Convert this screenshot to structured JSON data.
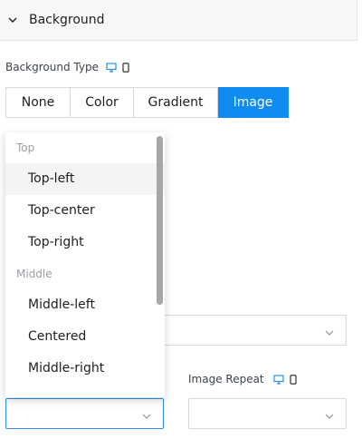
{
  "panel": {
    "title": "Background"
  },
  "background_type": {
    "label": "Background Type",
    "options": [
      "None",
      "Color",
      "Gradient",
      "Image"
    ],
    "selected": "Image"
  },
  "position_dropdown": {
    "groups": [
      {
        "label": "Top",
        "items": [
          "Top-left",
          "Top-center",
          "Top-right"
        ]
      },
      {
        "label": "Middle",
        "items": [
          "Middle-left",
          "Centered",
          "Middle-right"
        ]
      }
    ],
    "hovered": "Top-left"
  },
  "image_repeat": {
    "label": "Image Repeat"
  },
  "colors": {
    "accent": "#0f8cf2",
    "border": "#d6d9dd",
    "focus": "#2b8fe8"
  }
}
